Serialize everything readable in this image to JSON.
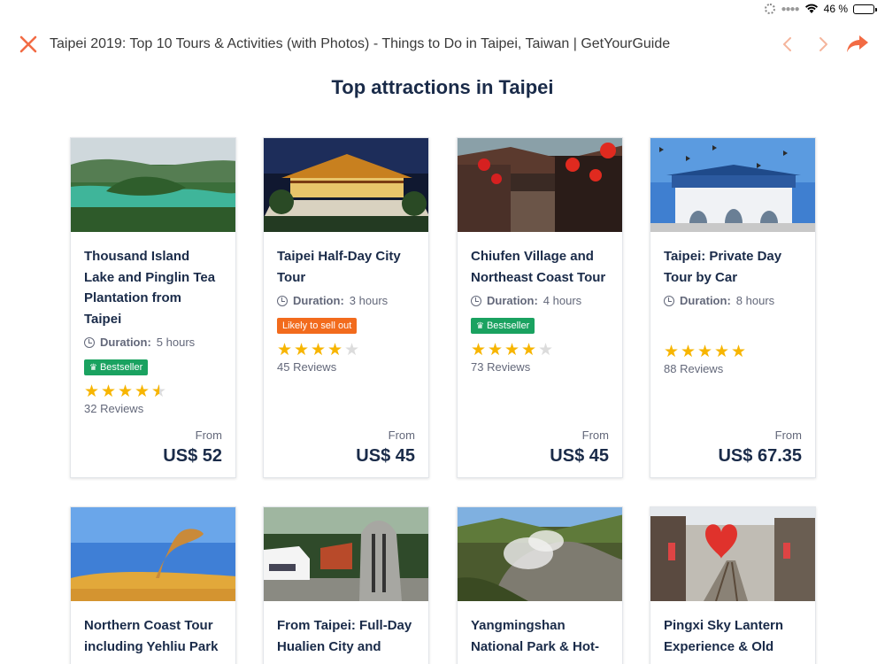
{
  "status": {
    "battery": "46 %"
  },
  "browser": {
    "page_title": "Taipei 2019: Top 10 Tours & Activities (with Photos) - Things to Do in Taipei, Taiwan | GetYourGuide",
    "accent": "#f26b44"
  },
  "section_title": "Top attractions in Taipei",
  "cards_row1": [
    {
      "title": "Thousand Island Lake and Pinglin Tea Plantation from Taipei",
      "duration_label": "Duration:",
      "duration_value": "5 hours",
      "badge": "Bestseller",
      "rating": 4.5,
      "reviews": "32 Reviews",
      "from": "From",
      "price": "US$ 52"
    },
    {
      "title": "Taipei Half-Day City Tour",
      "duration_label": "Duration:",
      "duration_value": "3 hours",
      "badge": "Likely to sell out",
      "rating": 4,
      "reviews": "45 Reviews",
      "from": "From",
      "price": "US$ 45"
    },
    {
      "title": "Chiufen Village and Northeast Coast Tour",
      "duration_label": "Duration:",
      "duration_value": "4 hours",
      "badge": "Bestseller",
      "rating": 4,
      "reviews": "73 Reviews",
      "from": "From",
      "price": "US$ 45"
    },
    {
      "title": "Taipei: Private Day Tour by Car",
      "duration_label": "Duration:",
      "duration_value": "8 hours",
      "rating": 5,
      "reviews": "88 Reviews",
      "from": "From",
      "price": "US$ 67.35"
    }
  ],
  "cards_row2": [
    {
      "title": "Northern Coast Tour including Yehliu Park"
    },
    {
      "title": "From Taipei: Full-Day Hualien City and"
    },
    {
      "title": "Yangmingshan National Park & Hot-"
    },
    {
      "title": "Pingxi Sky Lantern Experience & Old"
    }
  ],
  "colors": {
    "bestseller": "#1aa260",
    "sellout": "#f26b1d",
    "star": "#f7b500",
    "navy": "#1a2b49"
  }
}
